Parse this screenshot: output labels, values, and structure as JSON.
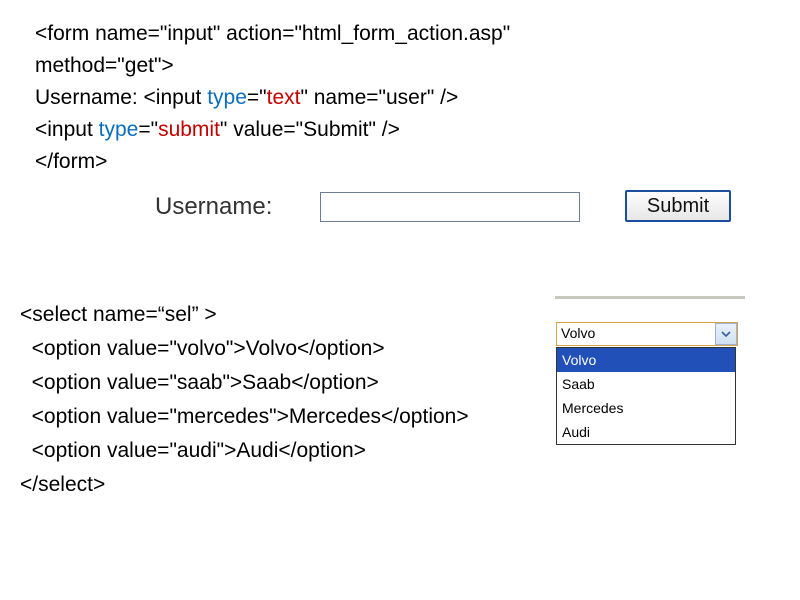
{
  "code_form": {
    "l1_a": "<form name=\"input\" action=\"html_form_action.asp\"",
    "l1_b": "method=\"get\">",
    "l2_a": "Username: <input ",
    "l2_type": "type",
    "l2_eq": "=\"",
    "l2_val": "text",
    "l2_b": "\" name=\"user\" />",
    "l3_a": "<input ",
    "l3_type": "type",
    "l3_eq": "=\"",
    "l3_val": "submit",
    "l3_b": "\" value=\"Submit\" />",
    "l4": "</form>"
  },
  "form_render": {
    "label": "Username:",
    "input_value": "",
    "submit_label": "Submit"
  },
  "code_select": {
    "l1": "<select name=“sel” >",
    "l2": "  <option value=\"volvo\">Volvo</option>",
    "l3": "  <option value=\"saab\">Saab</option>",
    "l4": "  <option value=\"mercedes\">Mercedes</option>",
    "l5": "  <option value=\"audi\">Audi</option>",
    "l6": "</select>"
  },
  "select_render": {
    "selected": "Volvo",
    "options": [
      "Volvo",
      "Saab",
      "Mercedes",
      "Audi"
    ],
    "highlighted_index": 0
  }
}
